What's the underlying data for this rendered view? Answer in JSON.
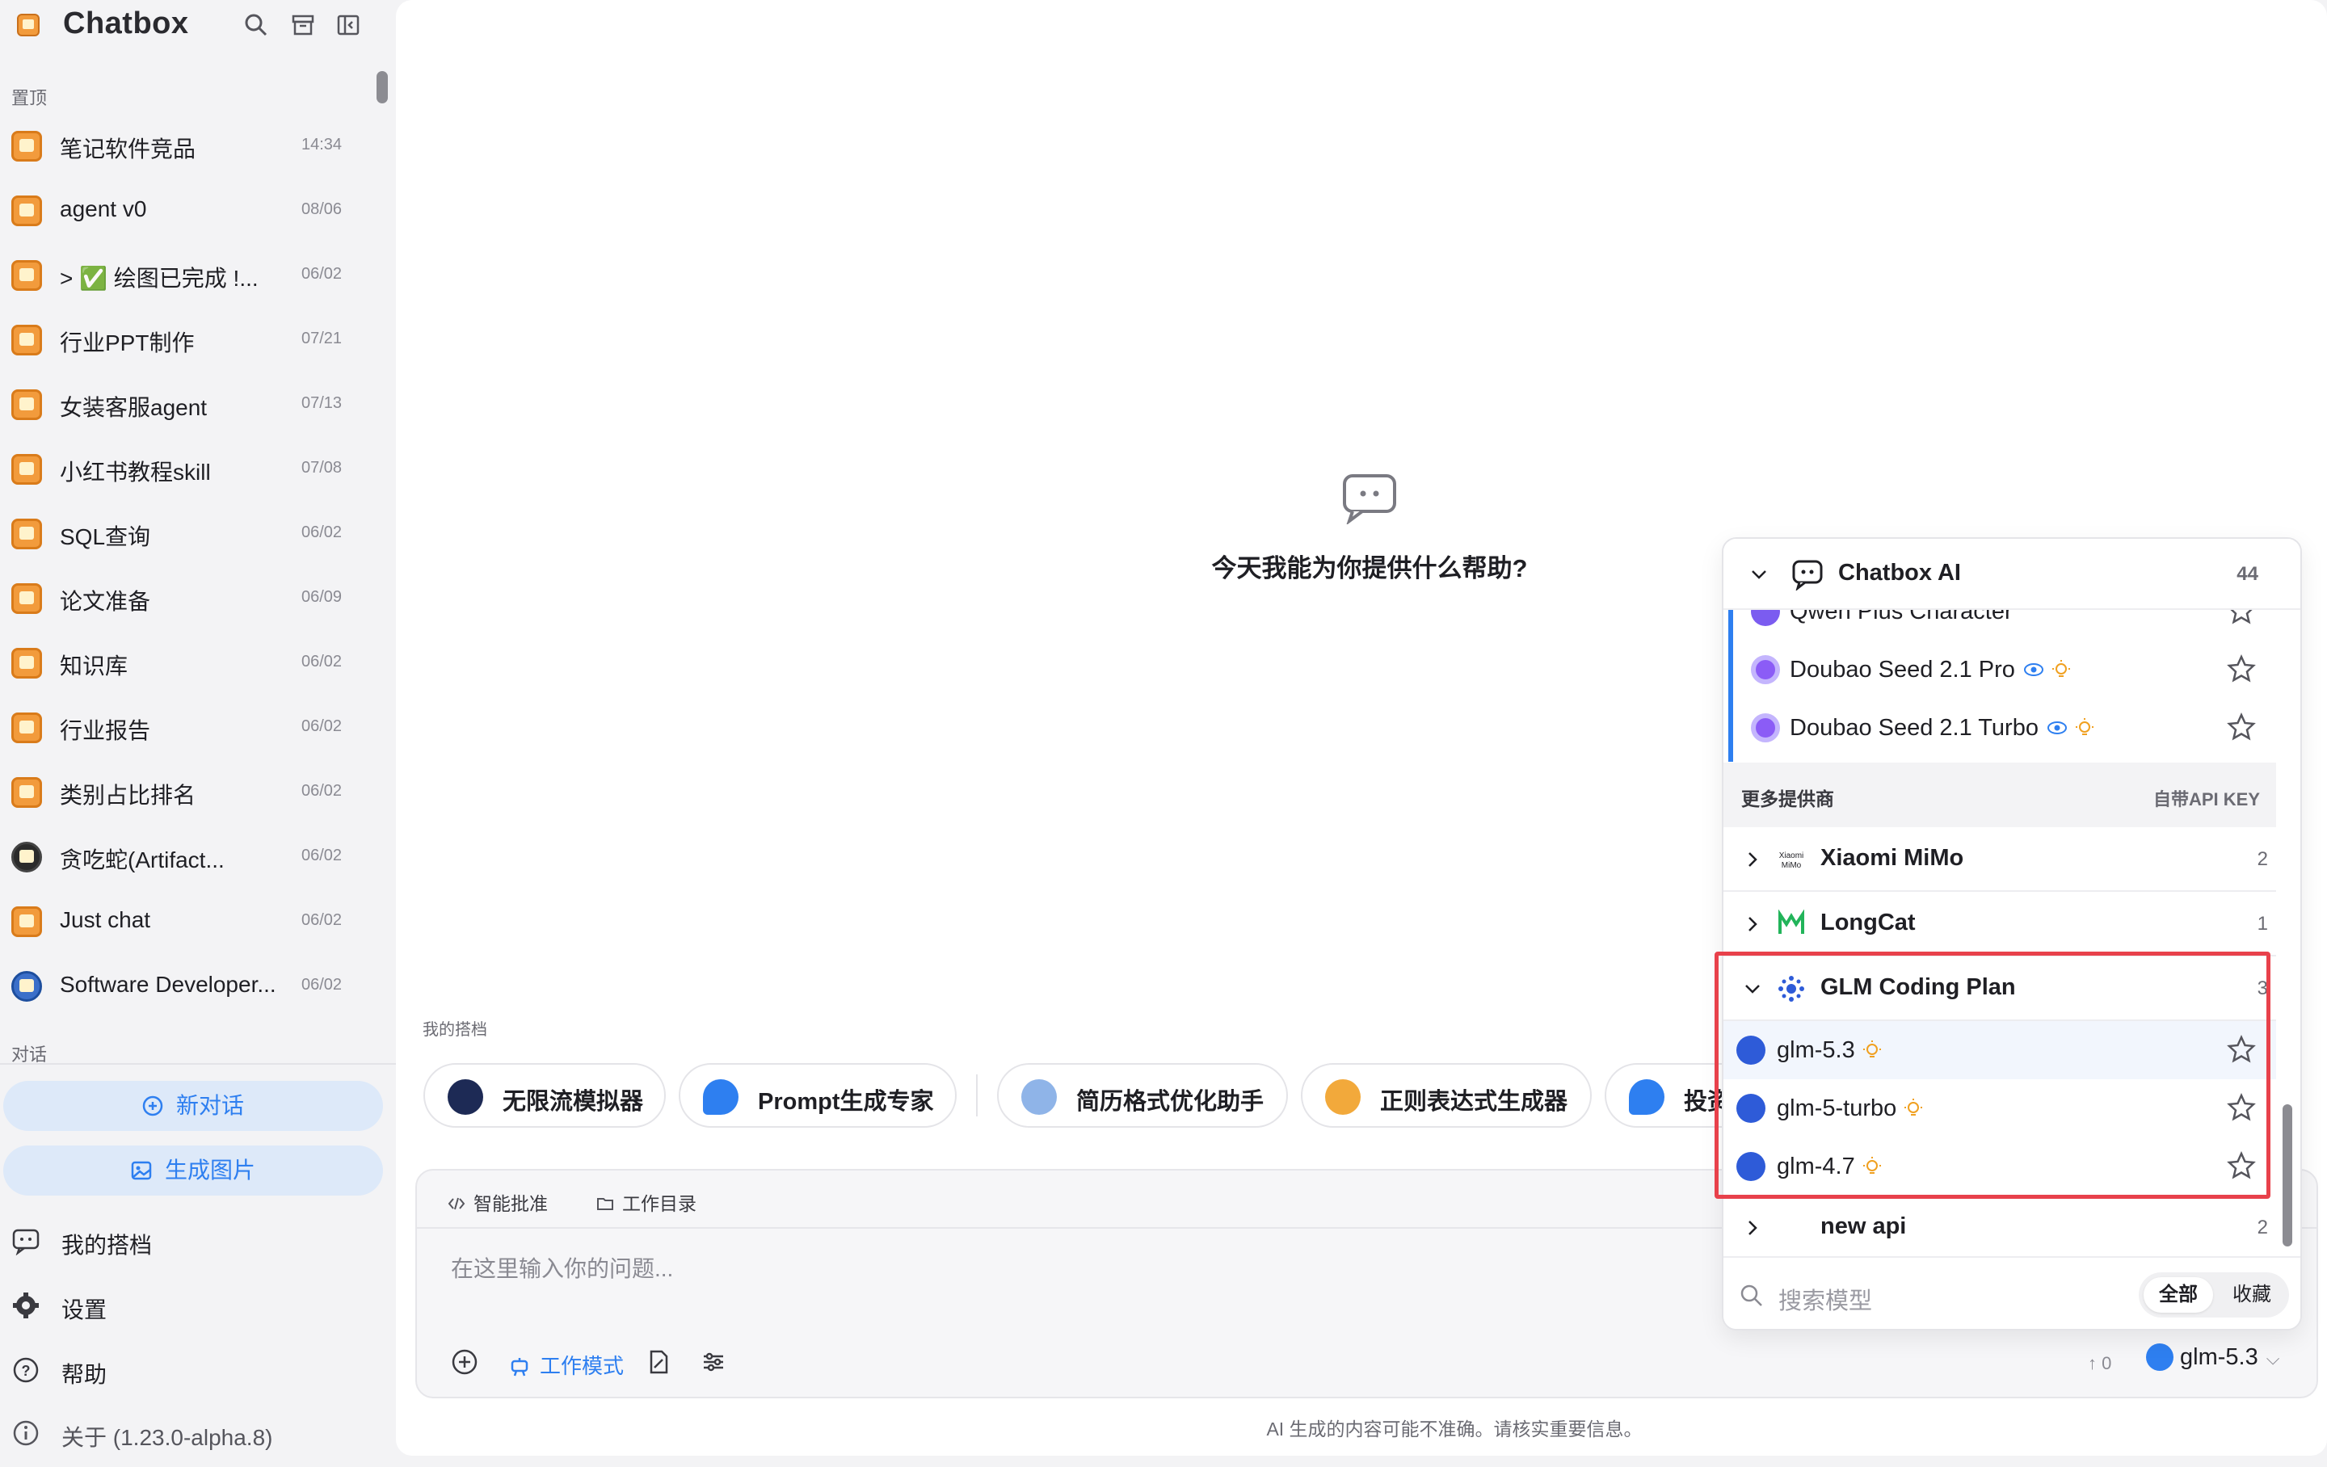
{
  "app": {
    "title": "Chatbox"
  },
  "sidebar": {
    "pinned_label": "置顶",
    "chats_label": "对话",
    "pinned": [
      {
        "title": "笔记软件竞品",
        "time": "14:34"
      },
      {
        "title": "agent v0",
        "time": "08/06"
      },
      {
        "title": "> ✅ 绘图已完成 !...",
        "time": "06/02"
      },
      {
        "title": "行业PPT制作",
        "time": "07/21"
      },
      {
        "title": "女装客服agent",
        "time": "07/13"
      },
      {
        "title": "小红书教程skill",
        "time": "07/08"
      },
      {
        "title": "SQL查询",
        "time": "06/02"
      },
      {
        "title": "论文准备",
        "time": "06/09"
      },
      {
        "title": "知识库",
        "time": "06/02"
      },
      {
        "title": "行业报告",
        "time": "06/02"
      },
      {
        "title": "类别占比排名",
        "time": "06/02"
      },
      {
        "title": "贪吃蛇(Artifact...",
        "time": "06/02"
      },
      {
        "title": "Just chat",
        "time": "06/02"
      },
      {
        "title": "Software Developer...",
        "time": "06/02"
      }
    ],
    "new_chat": "新对话",
    "gen_image": "生成图片",
    "nav": [
      {
        "label": "我的搭档",
        "icon": "partner-icon"
      },
      {
        "label": "设置",
        "icon": "gear-icon"
      },
      {
        "label": "帮助",
        "icon": "help-icon"
      },
      {
        "label": "关于 (1.23.0-alpha.8)",
        "icon": "info-icon"
      }
    ]
  },
  "main": {
    "welcome": "今天我能为你提供什么帮助?",
    "partners_label": "我的搭档",
    "partners": [
      {
        "label": "无限流模拟器"
      },
      {
        "label": "Prompt生成专家"
      },
      {
        "label": "简历格式优化助手"
      },
      {
        "label": "正则表达式生成器"
      },
      {
        "label": "投资"
      }
    ],
    "input": {
      "auto_approve": "智能批准",
      "work_dir": "工作目录",
      "placeholder": "在这里输入你的问题...",
      "work_mode": "工作模式",
      "token_count": "↑ 0",
      "current_model": "glm-5.3"
    },
    "disclaimer": "AI 生成的内容可能不准确。请核实重要信息。"
  },
  "model_menu": {
    "provider": "Chatbox AI",
    "provider_count": "44",
    "models": [
      {
        "name": "Qwen Plus Character"
      },
      {
        "name": "Doubao Seed 2.1 Pro"
      },
      {
        "name": "Doubao Seed 2.1 Turbo"
      }
    ],
    "more_providers": "更多提供商",
    "byok": "自带API KEY",
    "providers": [
      {
        "name": "Xiaomi MiMo",
        "count": "2"
      },
      {
        "name": "LongCat",
        "count": "1"
      },
      {
        "name": "GLM Coding Plan",
        "count": "3"
      }
    ],
    "glm_models": [
      {
        "name": "glm-5.3"
      },
      {
        "name": "glm-5-turbo"
      },
      {
        "name": "glm-4.7"
      }
    ],
    "new_api": {
      "name": "new api",
      "count": "2"
    },
    "search_placeholder": "搜索模型",
    "filter_all": "全部",
    "filter_fav": "收藏"
  }
}
